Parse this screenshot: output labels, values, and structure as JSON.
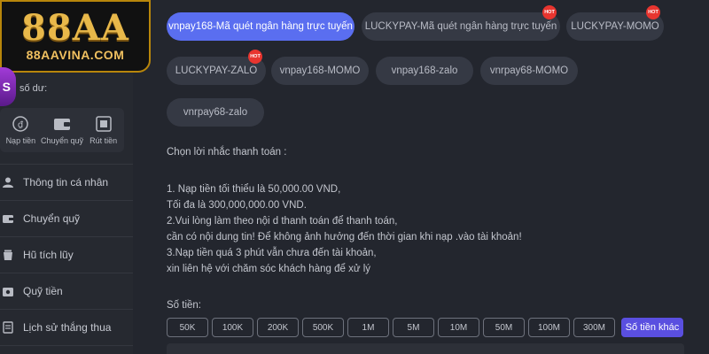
{
  "brand": {
    "logo_text": "88AA",
    "logo_sub": "88AAVINA.COM",
    "badge_letter": "S"
  },
  "sidebar": {
    "balance_label": "số dư:",
    "quick_actions": [
      {
        "label": "Nạp tiền",
        "icon": "deposit-icon"
      },
      {
        "label": "Chuyển quỹ",
        "icon": "wallet-icon"
      },
      {
        "label": "Rút tiền",
        "icon": "withdraw-icon"
      }
    ],
    "menu": [
      {
        "label": "Thông tin cá nhân",
        "icon": "user-icon"
      },
      {
        "label": "Chuyển quỹ",
        "icon": "wallet-icon"
      },
      {
        "label": "Hũ tích lũy",
        "icon": "jar-icon"
      },
      {
        "label": "Quỹ tiền",
        "icon": "fund-icon"
      },
      {
        "label": "Lịch sử thắng thua",
        "icon": "history-icon"
      }
    ]
  },
  "payment_channels": [
    {
      "label": "vnpay168-Mã quét ngân hàng trực tuyến",
      "active": true,
      "hot": false
    },
    {
      "label": "LUCKYPAY-Mã quét ngân hàng trực tuyến",
      "active": false,
      "hot": true
    },
    {
      "label": "LUCKYPAY-MOMO",
      "active": false,
      "hot": true
    },
    {
      "label": "LUCKYPAY-ZALO",
      "active": false,
      "hot": true
    },
    {
      "label": "vnpay168-MOMO",
      "active": false,
      "hot": false
    },
    {
      "label": "vnpay168-zalo",
      "active": false,
      "hot": false
    },
    {
      "label": "vnrpay68-MOMO",
      "active": false,
      "hot": false
    },
    {
      "label": "vnrpay68-zalo",
      "active": false,
      "hot": false
    }
  ],
  "hot_badge": "HOT",
  "instructions": {
    "title": "Chọn lời nhắc thanh toán :",
    "lines": [
      "1. Nạp tiền tối thiểu là 50,000.00 VND,",
      "Tối đa là 300,000,000.00 VND.",
      "2.Vui lòng làm theo nội d thanh toán để thanh toán,",
      "cần có nội dung tin! Để không ảnh hưởng đến thời gian khi nạp .vào tài khoản!",
      "3.Nạp tiền quá 3 phút vẫn chưa đến tài khoản,",
      "xin liên hệ với chăm sóc khách hàng để xử lý"
    ]
  },
  "amount": {
    "label": "Số tiền:",
    "options": [
      "50K",
      "100K",
      "200K",
      "500K",
      "1M",
      "5M",
      "10M",
      "50M",
      "100M",
      "300M"
    ],
    "other_label": "Số tiền khác"
  },
  "colors": {
    "accent": "#5a6ef0",
    "hot": "#e8352f",
    "other_button": "#5a4fe0",
    "logo_gold": "#e8b84a"
  }
}
